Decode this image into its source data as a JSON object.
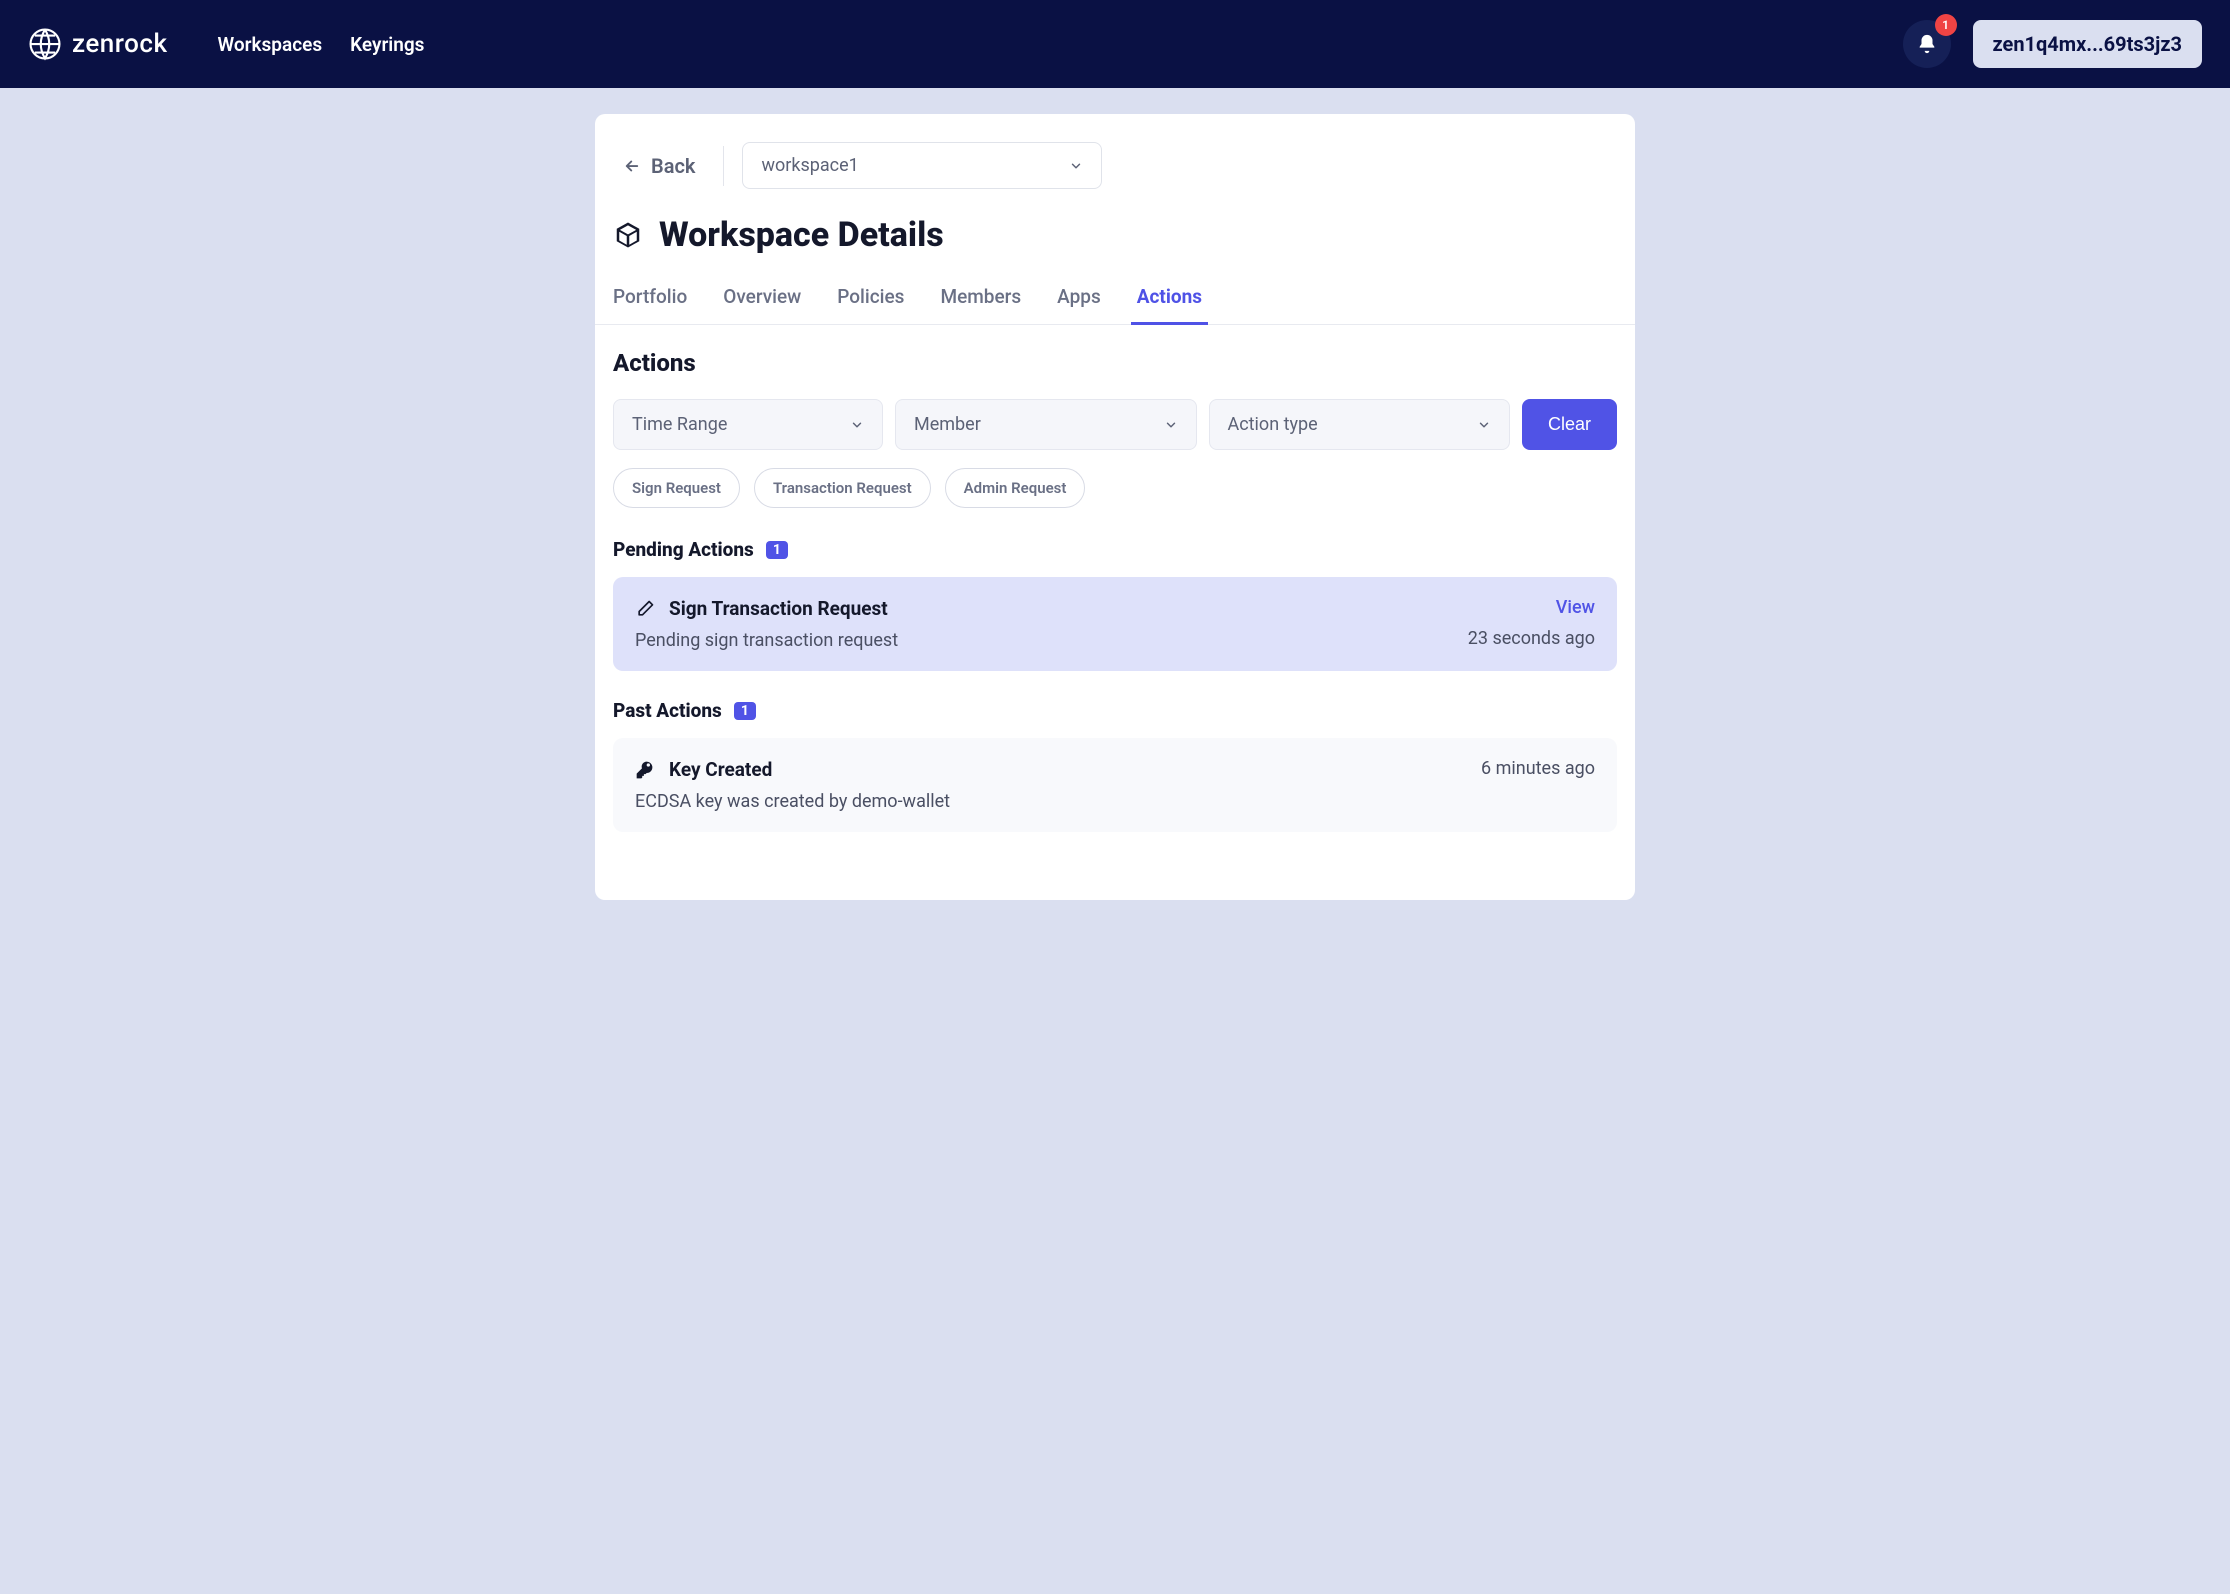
{
  "brand": "zenrock",
  "nav": {
    "workspaces": "Workspaces",
    "keyrings": "Keyrings"
  },
  "notif_count": "1",
  "address": "zen1q4mx...69ts3jz3",
  "back_label": "Back",
  "workspace_selected": "workspace1",
  "page_title": "Workspace Details",
  "tabs": {
    "portfolio": "Portfolio",
    "overview": "Overview",
    "policies": "Policies",
    "members": "Members",
    "apps": "Apps",
    "actions": "Actions"
  },
  "section_title": "Actions",
  "filters": {
    "time_range": "Time Range",
    "member": "Member",
    "action_type": "Action type",
    "clear": "Clear"
  },
  "chips": {
    "sign_request": "Sign Request",
    "transaction_request": "Transaction Request",
    "admin_request": "Admin Request"
  },
  "pending": {
    "title": "Pending Actions",
    "count": "1",
    "item": {
      "title": "Sign Transaction Request",
      "desc": "Pending sign transaction request",
      "view": "View",
      "time": "23 seconds ago"
    }
  },
  "past": {
    "title": "Past Actions",
    "count": "1",
    "item": {
      "title": "Key Created",
      "desc": "ECDSA key was created by demo-wallet",
      "time": "6 minutes ago"
    }
  }
}
